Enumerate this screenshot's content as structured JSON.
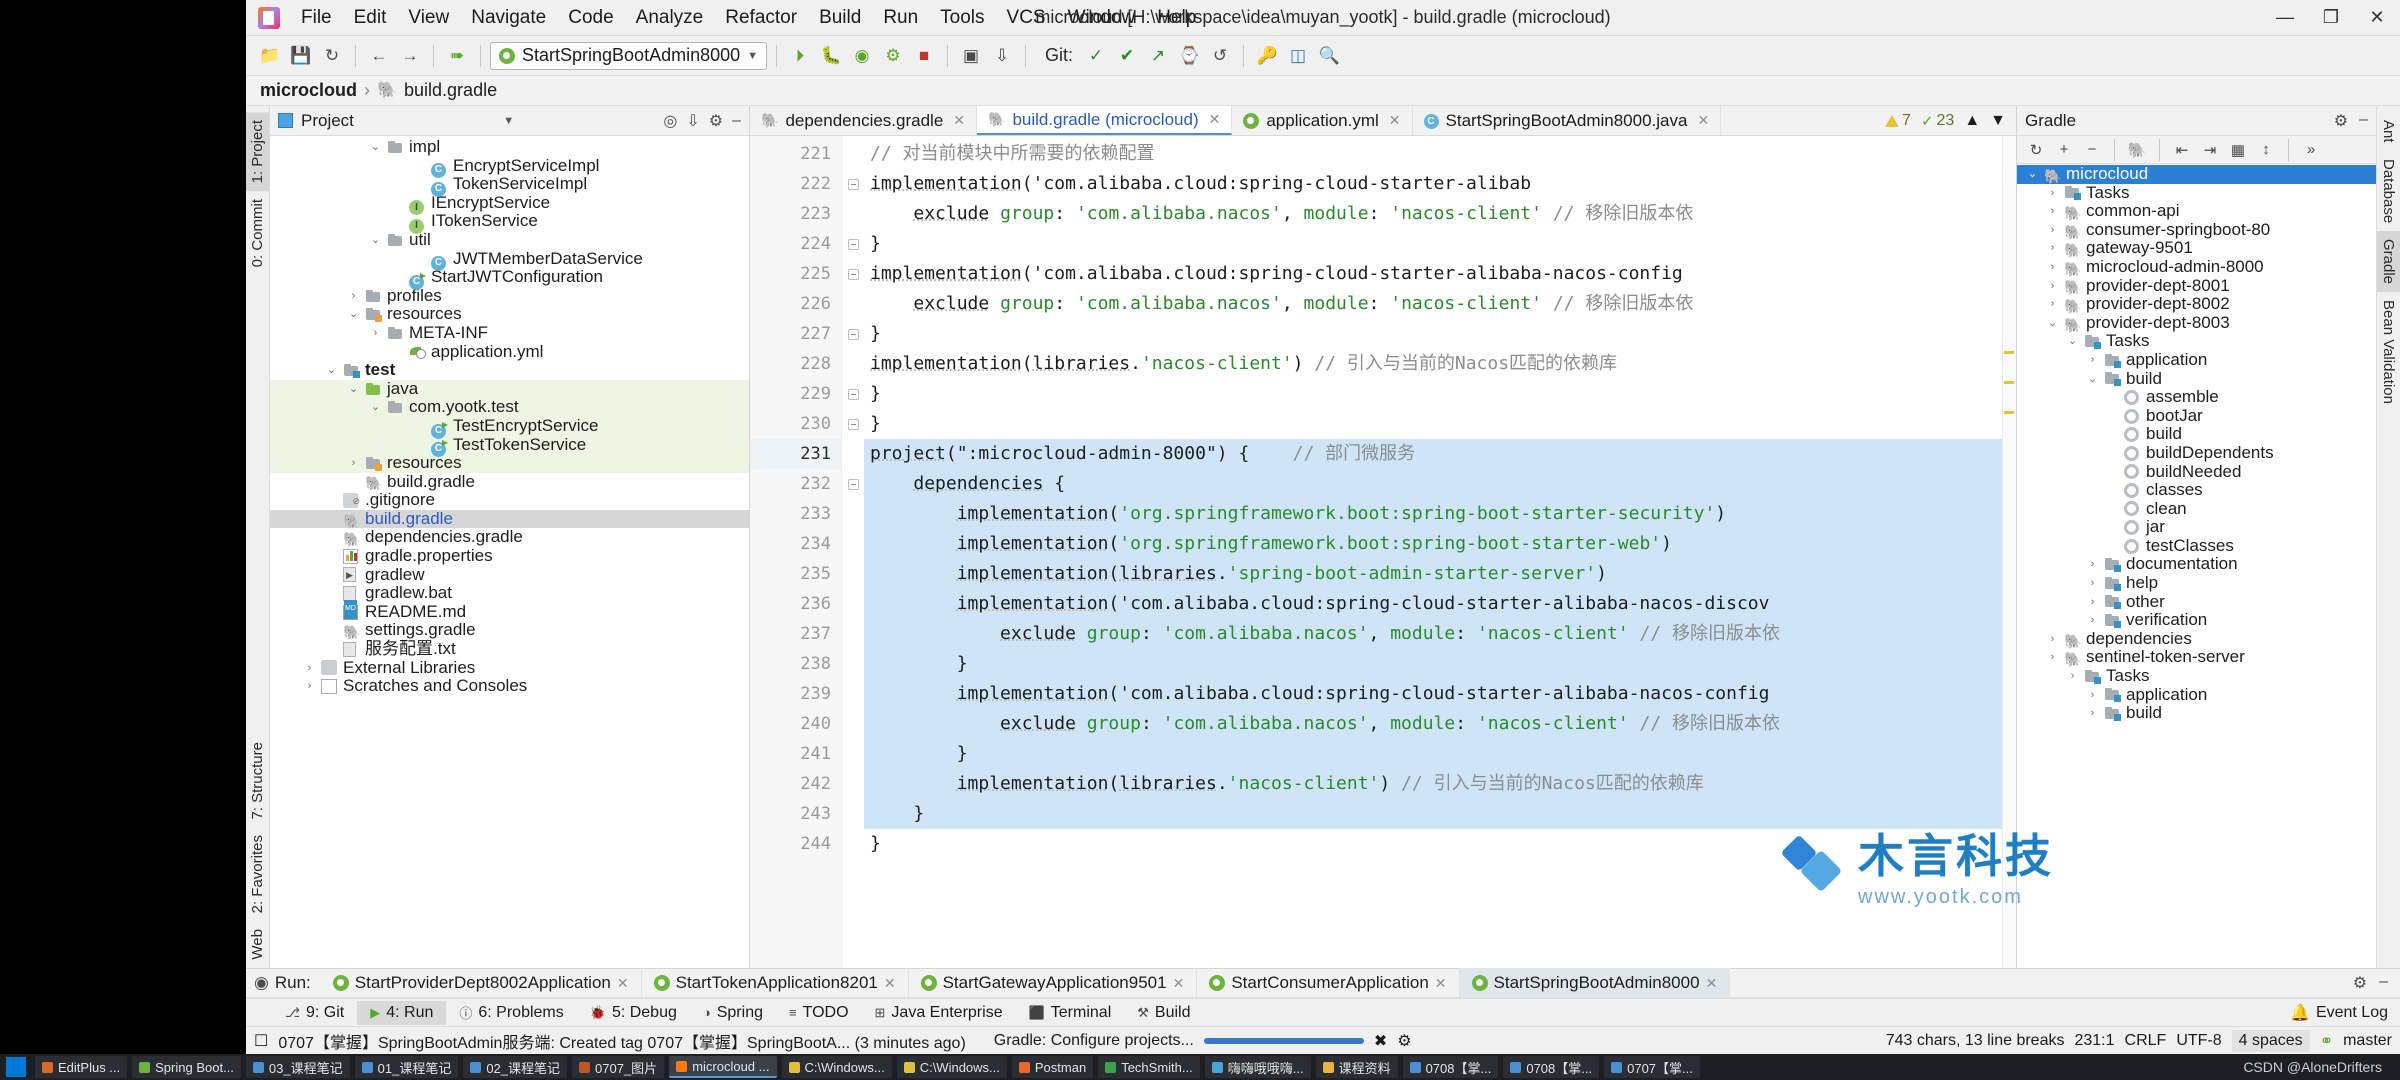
{
  "window": {
    "title": "microcloud [H:\\workspace\\idea\\muyan_yootk] - build.gradle (microcloud)",
    "minimize": "—",
    "maximize": "❐",
    "close": "✕"
  },
  "menu": [
    "File",
    "Edit",
    "View",
    "Navigate",
    "Code",
    "Analyze",
    "Refactor",
    "Build",
    "Run",
    "Tools",
    "VCS",
    "Window",
    "Help"
  ],
  "toolbar": {
    "run_config": "StartSpringBootAdmin8000",
    "git_label": "Git:",
    "icons": [
      "open-folder-icon",
      "save-icon",
      "sync-icon",
      "back-arrow-icon",
      "forward-arrow-icon",
      "build-icon",
      "run-icon",
      "debug-icon",
      "coverage-icon",
      "profile-icon",
      "stop-icon",
      "apply-icon",
      "update-icon",
      "commit-icon",
      "push-icon",
      "history-icon",
      "rollback-icon",
      "key-icon",
      "database-icon",
      "search-icon"
    ]
  },
  "breadcrumb": {
    "project": "microcloud",
    "file": "build.gradle",
    "separator": "›"
  },
  "left_strip": {
    "tabs": [
      "1: Project",
      "0: Commit",
      "7: Structure",
      "2: Favorites",
      "Web"
    ]
  },
  "right_strip": {
    "tabs": [
      "Ant",
      "Database",
      "Gradle",
      "Bean Validation"
    ]
  },
  "project_panel": {
    "title": "Project",
    "tree": [
      {
        "depth": 4,
        "arrow": "v",
        "icon": "folder",
        "label": "impl"
      },
      {
        "depth": 6,
        "arrow": "",
        "icon": "class",
        "label": "EncryptServiceImpl"
      },
      {
        "depth": 6,
        "arrow": "",
        "icon": "class",
        "label": "TokenServiceImpl"
      },
      {
        "depth": 5,
        "arrow": "",
        "icon": "interface",
        "label": "IEncryptService"
      },
      {
        "depth": 5,
        "arrow": "",
        "icon": "interface",
        "label": "ITokenService"
      },
      {
        "depth": 4,
        "arrow": "v",
        "icon": "folder",
        "label": "util"
      },
      {
        "depth": 6,
        "arrow": "",
        "icon": "class",
        "label": "JWTMemberDataService"
      },
      {
        "depth": 5,
        "arrow": "",
        "icon": "class-run",
        "label": "StartJWTConfiguration"
      },
      {
        "depth": 3,
        "arrow": ">",
        "icon": "folder",
        "label": "profiles"
      },
      {
        "depth": 3,
        "arrow": "v",
        "icon": "folder-res",
        "label": "resources"
      },
      {
        "depth": 4,
        "arrow": ">",
        "icon": "folder",
        "label": "META-INF"
      },
      {
        "depth": 5,
        "arrow": "",
        "icon": "yml",
        "label": "application.yml"
      },
      {
        "depth": 2,
        "arrow": "v",
        "icon": "folder-test",
        "label": "test",
        "bold": true
      },
      {
        "depth": 3,
        "arrow": "v",
        "icon": "folder-green",
        "label": "java",
        "green": true
      },
      {
        "depth": 4,
        "arrow": "v",
        "icon": "folder",
        "label": "com.yootk.test",
        "green": true
      },
      {
        "depth": 6,
        "arrow": "",
        "icon": "class-run",
        "label": "TestEncryptService",
        "green": true
      },
      {
        "depth": 6,
        "arrow": "",
        "icon": "class-run",
        "label": "TestTokenService",
        "green": true
      },
      {
        "depth": 3,
        "arrow": ">",
        "icon": "folder-testres",
        "label": "resources",
        "green": true
      },
      {
        "depth": 3,
        "arrow": "",
        "icon": "gradle",
        "label": "build.gradle"
      },
      {
        "depth": 2,
        "arrow": "",
        "icon": "gitignore",
        "label": ".gitignore"
      },
      {
        "depth": 2,
        "arrow": "",
        "icon": "gradle",
        "label": "build.gradle",
        "selected": true,
        "blue": true
      },
      {
        "depth": 2,
        "arrow": "",
        "icon": "gradle",
        "label": "dependencies.gradle"
      },
      {
        "depth": 2,
        "arrow": "",
        "icon": "props",
        "label": "gradle.properties"
      },
      {
        "depth": 2,
        "arrow": "",
        "icon": "script",
        "label": "gradlew"
      },
      {
        "depth": 2,
        "arrow": "",
        "icon": "doc",
        "label": "gradlew.bat"
      },
      {
        "depth": 2,
        "arrow": "",
        "icon": "md",
        "label": "README.md"
      },
      {
        "depth": 2,
        "arrow": "",
        "icon": "gradle",
        "label": "settings.gradle"
      },
      {
        "depth": 2,
        "arrow": "",
        "icon": "doc",
        "label": "服务配置.txt"
      },
      {
        "depth": 1,
        "arrow": ">",
        "icon": "lib",
        "label": "External Libraries"
      },
      {
        "depth": 1,
        "arrow": ">",
        "icon": "scratch",
        "label": "Scratches and Consoles"
      }
    ]
  },
  "editor": {
    "tabs": [
      {
        "label": "dependencies.gradle",
        "icon": "gradle-icon",
        "active": false,
        "closable": true
      },
      {
        "label": "build.gradle (microcloud)",
        "icon": "gradle-icon",
        "active": true,
        "closable": true
      },
      {
        "label": "application.yml",
        "icon": "spring-icon",
        "active": false,
        "closable": true
      },
      {
        "label": "StartSpringBootAdmin8000.java",
        "icon": "java-icon",
        "active": false,
        "closable": true
      }
    ],
    "inspection": {
      "warnings": "7",
      "errors": "23",
      "warn_icon": "warning-triangle-icon",
      "err_icon": "check-icon"
    },
    "first_line": 221,
    "lines": [
      {
        "n": 221,
        "text": "// 对当前模块中所需要的依赖配置"
      },
      {
        "n": 222,
        "text": "implementation('com.alibaba.cloud:spring-cloud-starter-alibab"
      },
      {
        "n": 223,
        "text": "    exclude group: 'com.alibaba.nacos', module: 'nacos-client' // 移除旧版本依"
      },
      {
        "n": 224,
        "text": "}"
      },
      {
        "n": 225,
        "text": "implementation('com.alibaba.cloud:spring-cloud-starter-alibaba-nacos-config"
      },
      {
        "n": 226,
        "text": "    exclude group: 'com.alibaba.nacos', module: 'nacos-client' // 移除旧版本依"
      },
      {
        "n": 227,
        "text": "}"
      },
      {
        "n": 228,
        "text": "implementation(libraries.'nacos-client') // 引入与当前的Nacos匹配的依赖库"
      },
      {
        "n": 229,
        "text": "}"
      },
      {
        "n": 230,
        "text": "}"
      },
      {
        "n": 231,
        "text": "project(\":microcloud-admin-8000\") {    // 部门微服务"
      },
      {
        "n": 232,
        "text": "    dependencies {"
      },
      {
        "n": 233,
        "text": "        implementation('org.springframework.boot:spring-boot-starter-security')"
      },
      {
        "n": 234,
        "text": "        implementation('org.springframework.boot:spring-boot-starter-web')"
      },
      {
        "n": 235,
        "text": "        implementation(libraries.'spring-boot-admin-starter-server')"
      },
      {
        "n": 236,
        "text": "        implementation('com.alibaba.cloud:spring-cloud-starter-alibaba-nacos-discov"
      },
      {
        "n": 237,
        "text": "            exclude group: 'com.alibaba.nacos', module: 'nacos-client' // 移除旧版本依"
      },
      {
        "n": 238,
        "text": "        }"
      },
      {
        "n": 239,
        "text": "        implementation('com.alibaba.cloud:spring-cloud-starter-alibaba-nacos-config"
      },
      {
        "n": 240,
        "text": "            exclude group: 'com.alibaba.nacos', module: 'nacos-client' // 移除旧版本依"
      },
      {
        "n": 241,
        "text": "        }"
      },
      {
        "n": 242,
        "text": "        implementation(libraries.'nacos-client') // 引入与当前的Nacos匹配的依赖库"
      },
      {
        "n": 243,
        "text": "    }"
      },
      {
        "n": 244,
        "text": "}"
      }
    ]
  },
  "gradle_panel": {
    "title": "Gradle",
    "toolbar_icons": [
      "refresh-icon",
      "add-icon",
      "remove-icon",
      "gradle-elephant-icon",
      "expand-all-icon",
      "collapse-all-icon",
      "modules-icon",
      "toggle-offline-icon",
      "more-icon"
    ],
    "tree": [
      {
        "depth": 0,
        "arrow": "v",
        "icon": "gradle",
        "label": "microcloud",
        "selected": true
      },
      {
        "depth": 1,
        "arrow": ">",
        "icon": "tasks",
        "label": "Tasks"
      },
      {
        "depth": 1,
        "arrow": ">",
        "icon": "gradle",
        "label": "common-api"
      },
      {
        "depth": 1,
        "arrow": ">",
        "icon": "gradle",
        "label": "consumer-springboot-80"
      },
      {
        "depth": 1,
        "arrow": ">",
        "icon": "gradle",
        "label": "gateway-9501"
      },
      {
        "depth": 1,
        "arrow": ">",
        "icon": "gradle",
        "label": "microcloud-admin-8000"
      },
      {
        "depth": 1,
        "arrow": ">",
        "icon": "gradle",
        "label": "provider-dept-8001"
      },
      {
        "depth": 1,
        "arrow": ">",
        "icon": "gradle",
        "label": "provider-dept-8002"
      },
      {
        "depth": 1,
        "arrow": "v",
        "icon": "gradle",
        "label": "provider-dept-8003"
      },
      {
        "depth": 2,
        "arrow": "v",
        "icon": "tasks",
        "label": "Tasks"
      },
      {
        "depth": 3,
        "arrow": ">",
        "icon": "tasks",
        "label": "application"
      },
      {
        "depth": 3,
        "arrow": "v",
        "icon": "tasks",
        "label": "build"
      },
      {
        "depth": 4,
        "arrow": "",
        "icon": "gear",
        "label": "assemble"
      },
      {
        "depth": 4,
        "arrow": "",
        "icon": "gear",
        "label": "bootJar"
      },
      {
        "depth": 4,
        "arrow": "",
        "icon": "gear",
        "label": "build"
      },
      {
        "depth": 4,
        "arrow": "",
        "icon": "gear",
        "label": "buildDependents"
      },
      {
        "depth": 4,
        "arrow": "",
        "icon": "gear",
        "label": "buildNeeded"
      },
      {
        "depth": 4,
        "arrow": "",
        "icon": "gear",
        "label": "classes"
      },
      {
        "depth": 4,
        "arrow": "",
        "icon": "gear",
        "label": "clean"
      },
      {
        "depth": 4,
        "arrow": "",
        "icon": "gear",
        "label": "jar"
      },
      {
        "depth": 4,
        "arrow": "",
        "icon": "gear",
        "label": "testClasses"
      },
      {
        "depth": 3,
        "arrow": ">",
        "icon": "tasks",
        "label": "documentation"
      },
      {
        "depth": 3,
        "arrow": ">",
        "icon": "tasks",
        "label": "help"
      },
      {
        "depth": 3,
        "arrow": ">",
        "icon": "tasks",
        "label": "other"
      },
      {
        "depth": 3,
        "arrow": ">",
        "icon": "tasks",
        "label": "verification"
      },
      {
        "depth": 1,
        "arrow": ">",
        "icon": "gradle",
        "label": "dependencies"
      },
      {
        "depth": 1,
        "arrow": ">",
        "icon": "gradle",
        "label": "sentinel-token-server"
      },
      {
        "depth": 2,
        "arrow": ">",
        "icon": "tasks",
        "label": "Tasks"
      },
      {
        "depth": 3,
        "arrow": ">",
        "icon": "tasks",
        "label": "application"
      },
      {
        "depth": 3,
        "arrow": ">",
        "icon": "tasks",
        "label": "build"
      }
    ]
  },
  "run_window": {
    "label": "Run:",
    "tabs": [
      {
        "label": "StartProviderDept8002Application",
        "active": false
      },
      {
        "label": "StartTokenApplication8201",
        "active": false
      },
      {
        "label": "StartGatewayApplication9501",
        "active": false
      },
      {
        "label": "StartConsumerApplication",
        "active": false
      },
      {
        "label": "StartSpringBootAdmin8000",
        "active": true
      }
    ]
  },
  "bottom_tabs": [
    {
      "label": "9: Git",
      "icon": "git-icon",
      "active": false
    },
    {
      "label": "4: Run",
      "icon": "run-icon",
      "active": true
    },
    {
      "label": "6: Problems",
      "icon": "problems-icon",
      "active": false
    },
    {
      "label": "5: Debug",
      "icon": "debug-icon",
      "active": false
    },
    {
      "label": "Spring",
      "icon": "spring-icon",
      "active": false
    },
    {
      "label": "TODO",
      "icon": "todo-icon",
      "active": false
    },
    {
      "label": "Java Enterprise",
      "icon": "java-enterprise-icon",
      "active": false
    },
    {
      "label": "Terminal",
      "icon": "terminal-icon",
      "active": false
    },
    {
      "label": "Build",
      "icon": "build-icon",
      "active": false
    }
  ],
  "bottom_right": {
    "event_log": "Event Log",
    "bell_icon": "bell-icon"
  },
  "status_bar": {
    "vcs_message": "0707【掌握】SpringBootAdmin服务端: Created tag 0707【掌握】SpringBootA... (3 minutes ago)",
    "background_task": "Gradle: Configure projects...",
    "chars": "743 chars, 13 line breaks",
    "caret": "231:1",
    "line_sep": "CRLF",
    "encoding": "UTF-8",
    "indent": "4 spaces",
    "branch": "master"
  },
  "taskbar": {
    "items": [
      {
        "label": "EditPlus ...",
        "color": "#d96a2a",
        "active": false
      },
      {
        "label": "Spring Boot...",
        "color": "#6db33f",
        "active": false
      },
      {
        "label": "03_课程笔记",
        "color": "#4a8fd4",
        "active": false
      },
      {
        "label": "01_课程笔记",
        "color": "#4a8fd4",
        "active": false
      },
      {
        "label": "02_课程笔记",
        "color": "#4a8fd4",
        "active": false
      },
      {
        "label": "0707_图片",
        "color": "#c0542a",
        "active": false
      },
      {
        "label": "microcloud ...",
        "color": "#f97a12",
        "active": true
      },
      {
        "label": "C:\\Windows...",
        "color": "#e0c040",
        "active": false
      },
      {
        "label": "C:\\Windows...",
        "color": "#e0c040",
        "active": false
      },
      {
        "label": "Postman",
        "color": "#f0662a",
        "active": false
      },
      {
        "label": "TechSmith...",
        "color": "#3ba34b",
        "active": false
      },
      {
        "label": "嗨嗨哦哦嗨...",
        "color": "#4aa3d8",
        "active": false
      },
      {
        "label": "课程资料",
        "color": "#e8b33d",
        "active": false
      },
      {
        "label": "0708【掌...",
        "color": "#4a8fd4",
        "active": false
      },
      {
        "label": "0708【掌...",
        "color": "#4a8fd4",
        "active": false
      },
      {
        "label": "0707【掌...",
        "color": "#4a8fd4",
        "active": false
      }
    ],
    "credit": "CSDN @AloneDrifters"
  },
  "watermark": {
    "main": "木言科技",
    "sub": "www.yootk.com"
  }
}
